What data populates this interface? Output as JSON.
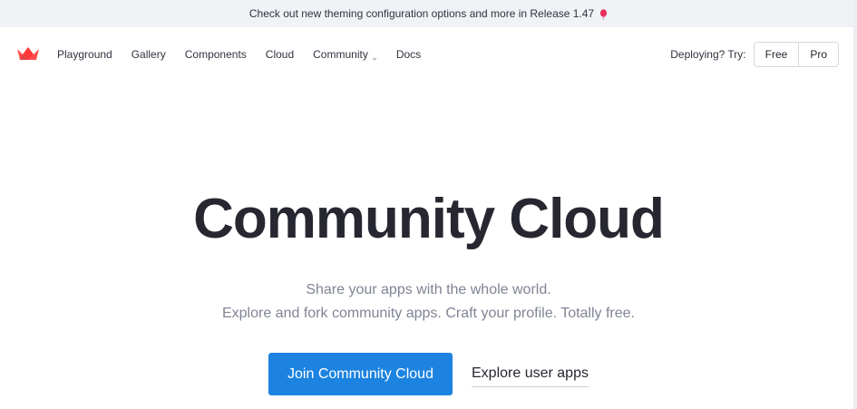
{
  "banner": {
    "text": "Check out new theming configuration options and more in Release 1.47",
    "icon": "balloon-icon"
  },
  "nav": {
    "logo": "streamlit-crown-logo",
    "links": [
      {
        "label": "Playground"
      },
      {
        "label": "Gallery"
      },
      {
        "label": "Components"
      },
      {
        "label": "Cloud"
      },
      {
        "label": "Community",
        "has_dropdown": true
      },
      {
        "label": "Docs"
      }
    ],
    "deploy_label": "Deploying? Try:",
    "free_label": "Free",
    "pro_label": "Pro"
  },
  "hero": {
    "title": "Community Cloud",
    "subtitle_line1": "Share your apps with the whole world.",
    "subtitle_line2": "Explore and fork community apps. Craft your profile. Totally free.",
    "primary_cta": "Join Community Cloud",
    "secondary_cta": "Explore user apps"
  },
  "colors": {
    "brand": "#ff4b4b",
    "primary_button": "#1c83e1",
    "banner_bg": "#f0f2f6",
    "subtitle": "#808495"
  }
}
